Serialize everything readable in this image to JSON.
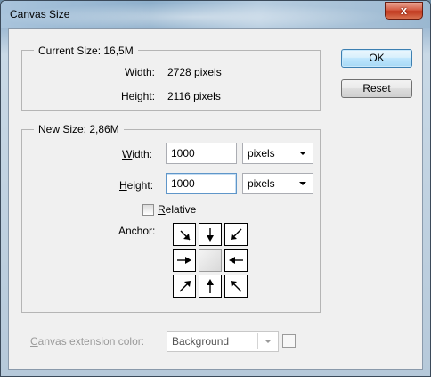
{
  "window": {
    "title": "Canvas Size",
    "close_glyph": "x"
  },
  "current_size": {
    "legend": "Current Size: 16,5M",
    "width_label": "Width:",
    "width_value": "2728 pixels",
    "height_label": "Height:",
    "height_value": "2116 pixels"
  },
  "new_size": {
    "legend": "New Size: 2,86M",
    "width_label": "Width:",
    "width_value": "1000",
    "width_unit": "pixels",
    "height_label": "Height:",
    "height_value": "1000",
    "height_unit": "pixels",
    "relative_label": "Relative",
    "relative_checked": false,
    "anchor_label": "Anchor:"
  },
  "buttons": {
    "ok": "OK",
    "reset": "Reset"
  },
  "extension": {
    "label": "Canvas extension color:",
    "value": "Background"
  },
  "icons": {
    "close": "close-icon",
    "anchor": [
      "arrow-nw-icon",
      "arrow-n-icon",
      "arrow-ne-icon",
      "arrow-w-icon",
      "anchor-center",
      "arrow-e-icon",
      "arrow-sw-icon",
      "arrow-s-icon",
      "arrow-se-icon"
    ],
    "dropdown": "chevron-down-icon"
  },
  "colors": {
    "accent_border": "#3c7fb1",
    "close_red": "#c0391f"
  }
}
